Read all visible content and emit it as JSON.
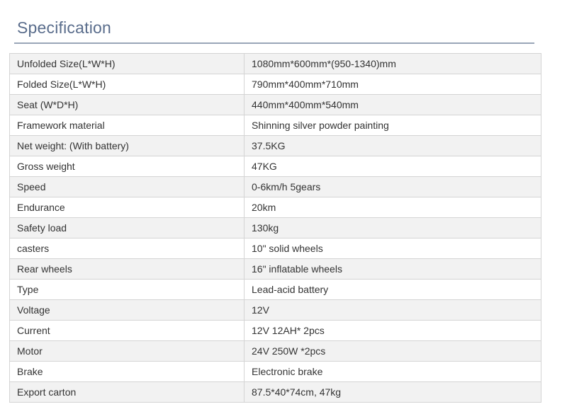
{
  "section": {
    "title": "Specification"
  },
  "rows": [
    {
      "label": "Unfolded Size(L*W*H)",
      "value": "1080mm*600mm*(950-1340)mm"
    },
    {
      "label": "Folded Size(L*W*H)",
      "value": "790mm*400mm*710mm"
    },
    {
      "label": "Seat (W*D*H)",
      "value": "440mm*400mm*540mm"
    },
    {
      "label": "Framework material",
      "value": "Shinning silver powder painting"
    },
    {
      "label": "Net weight: (With battery)",
      "value": "37.5KG"
    },
    {
      "label": "Gross weight",
      "value": "47KG"
    },
    {
      "label": "Speed",
      "value": "0-6km/h 5gears"
    },
    {
      "label": "Endurance",
      "value": "20km"
    },
    {
      "label": "Safety load",
      "value": "130kg"
    },
    {
      "label": "casters",
      "value": "10\" solid wheels"
    },
    {
      "label": "Rear wheels",
      "value": "16\" inflatable wheels"
    },
    {
      "label": "Type",
      "value": "Lead-acid battery"
    },
    {
      "label": "Voltage",
      "value": "12V"
    },
    {
      "label": "Current",
      "value": "12V 12AH* 2pcs"
    },
    {
      "label": "Motor",
      "value": "24V 250W *2pcs"
    },
    {
      "label": "Brake",
      "value": "Electronic brake"
    },
    {
      "label": "Export carton",
      "value": "87.5*40*74cm, 47kg"
    }
  ]
}
